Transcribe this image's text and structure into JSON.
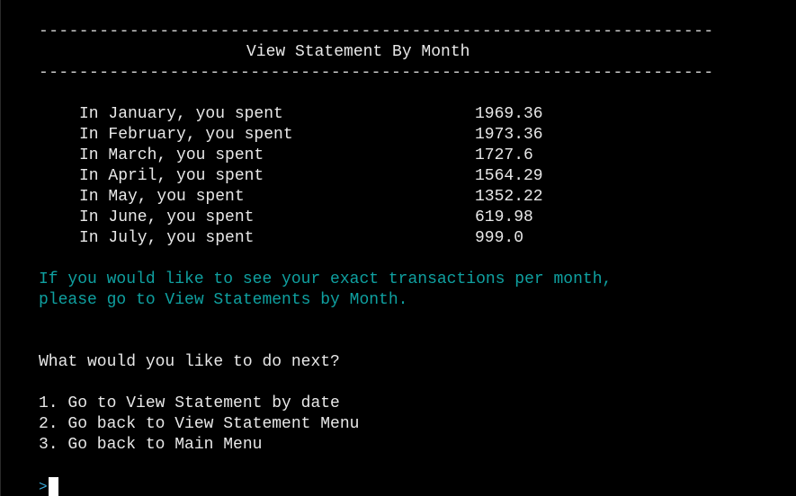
{
  "terminal": {
    "divider_top": "--------------------------------------------------------------------------------------------",
    "title": "View Statement By Month",
    "divider_bottom": "--------------------------------------------------------------------------------------------",
    "months": [
      {
        "label": "In January, you spent",
        "value": "1969.36"
      },
      {
        "label": "In February, you spent",
        "value": "1973.36"
      },
      {
        "label": "In March, you spent",
        "value": "1727.6"
      },
      {
        "label": "In April, you spent",
        "value": "1564.29"
      },
      {
        "label": "In May, you spent",
        "value": "1352.22"
      },
      {
        "label": "In June, you spent",
        "value": "619.98"
      },
      {
        "label": "In July, you spent",
        "value": "999.0"
      }
    ],
    "info_line_1": "If you would like to see your exact transactions per month,",
    "info_line_2": "please go to View Statements by Month.",
    "question": "What would you like to do next?",
    "options": [
      "1. Go to View Statement by date",
      "2. Go back to View Statement Menu",
      "3. Go back to Main Menu"
    ],
    "prompt_symbol": ">",
    "colors": {
      "background": "#000000",
      "text": "#e8e8e8",
      "info": "#0fa0a0",
      "prompt": "#3aa8d8",
      "cursor": "#ffffff"
    }
  }
}
